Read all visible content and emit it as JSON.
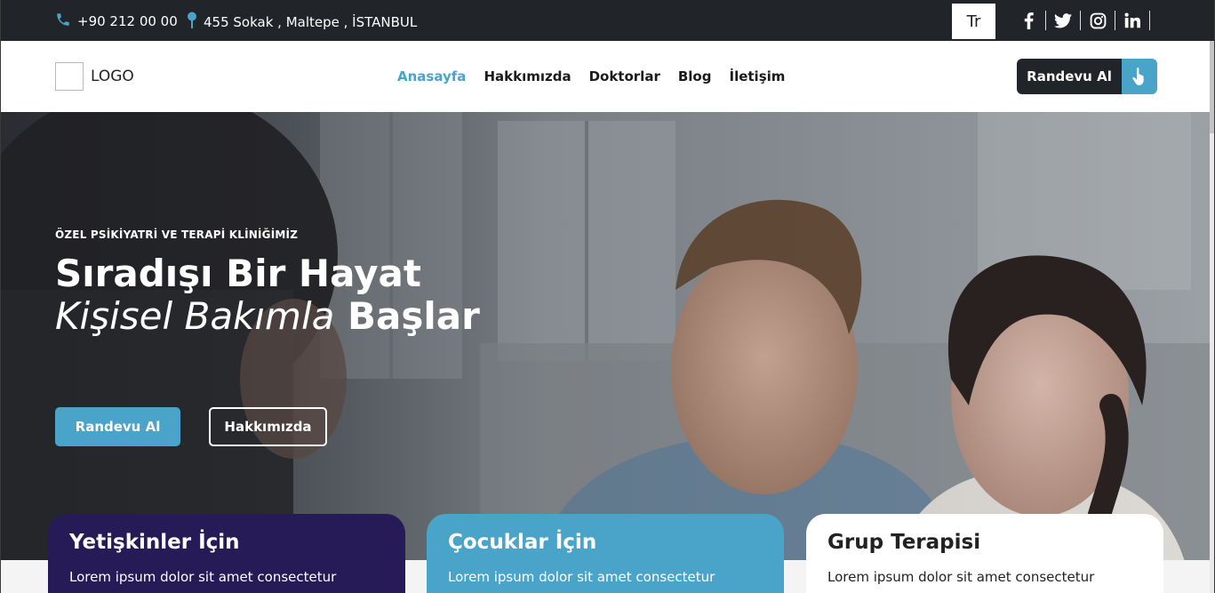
{
  "topbar": {
    "phone": "+90 212 00 00",
    "address": "455 Sokak , Maltepe , İSTANBUL",
    "language": "Tr",
    "social": [
      "facebook-icon",
      "twitter-icon",
      "instagram-icon",
      "linkedin-icon"
    ]
  },
  "header": {
    "logo_text": "LOGO",
    "nav": [
      {
        "label": "Anasayfa",
        "active": true
      },
      {
        "label": "Hakkımızda",
        "active": false
      },
      {
        "label": "Doktorlar",
        "active": false
      },
      {
        "label": "Blog",
        "active": false
      },
      {
        "label": "İletişim",
        "active": false
      }
    ],
    "cta_label": "Randevu Al"
  },
  "hero": {
    "eyebrow": "ÖZEL PSİKİYATRİ VE TERAPİ KLİNİĞİMİZ",
    "title_line1": "Sıradışı Bir Hayat",
    "title_line2_italic": "Kişisel Bakımla",
    "title_line2_bold": "Başlar",
    "primary_button": "Randevu Al",
    "secondary_button": "Hakkımızda"
  },
  "cards": [
    {
      "title": "Yetişkinler İçin",
      "text": "Lorem ipsum dolor sit amet consectetur"
    },
    {
      "title": "Çocuklar İçin",
      "text": "Lorem ipsum dolor sit amet consectetur"
    },
    {
      "title": "Grup Terapisi",
      "text": "Lorem ipsum dolor sit amet consectetur"
    }
  ],
  "colors": {
    "topbar": "#212529",
    "accent": "#4aa3c9",
    "card_dark": "#261a57",
    "card_light": "#ffffff"
  }
}
